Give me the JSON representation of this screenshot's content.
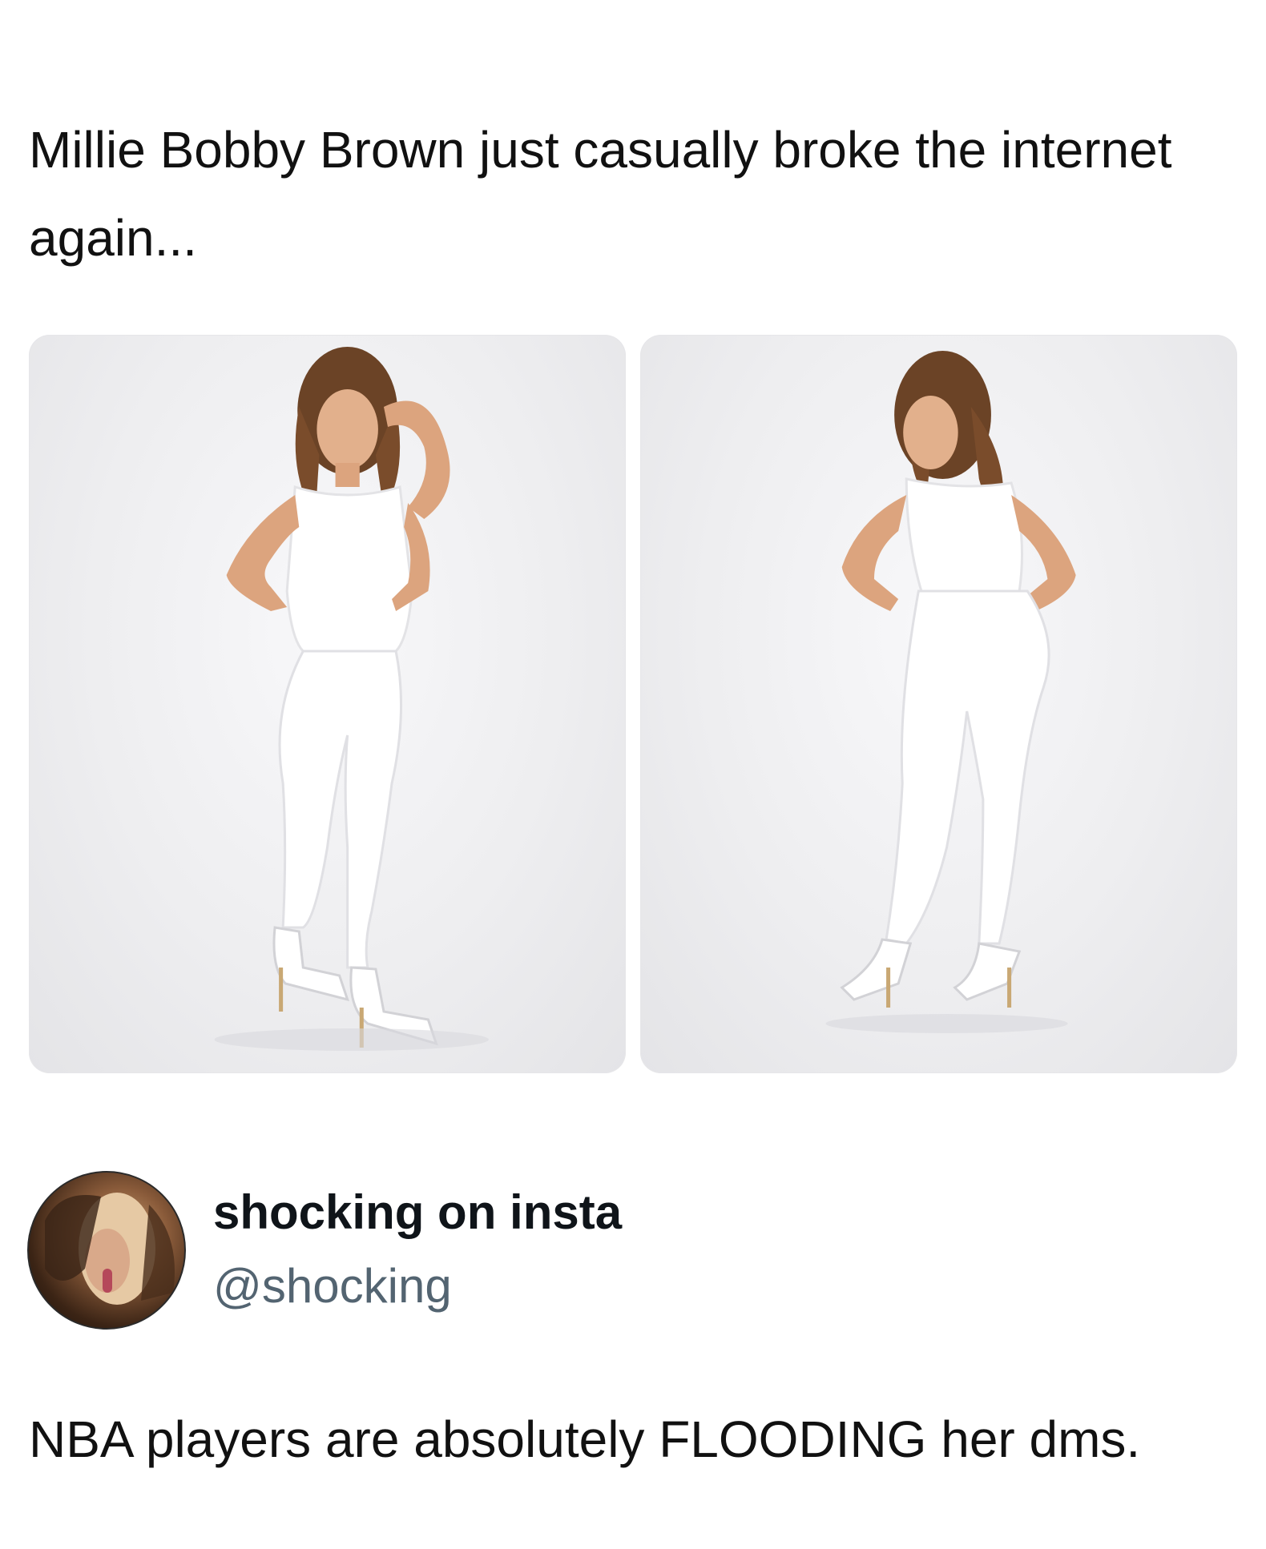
{
  "post": {
    "caption": "Millie Bobby Brown just casually broke the internet again..."
  },
  "photos": [
    {
      "description_icon": "photo-front-icon"
    },
    {
      "description_icon": "photo-back-icon"
    }
  ],
  "quoted_account": {
    "display_name": "shocking on insta",
    "handle": "@shocking",
    "tweet_text": "NBA players are absolutely FLOODING her dms."
  },
  "colors": {
    "text_primary": "#0f1419",
    "text_secondary": "#536471",
    "background": "#ffffff"
  }
}
